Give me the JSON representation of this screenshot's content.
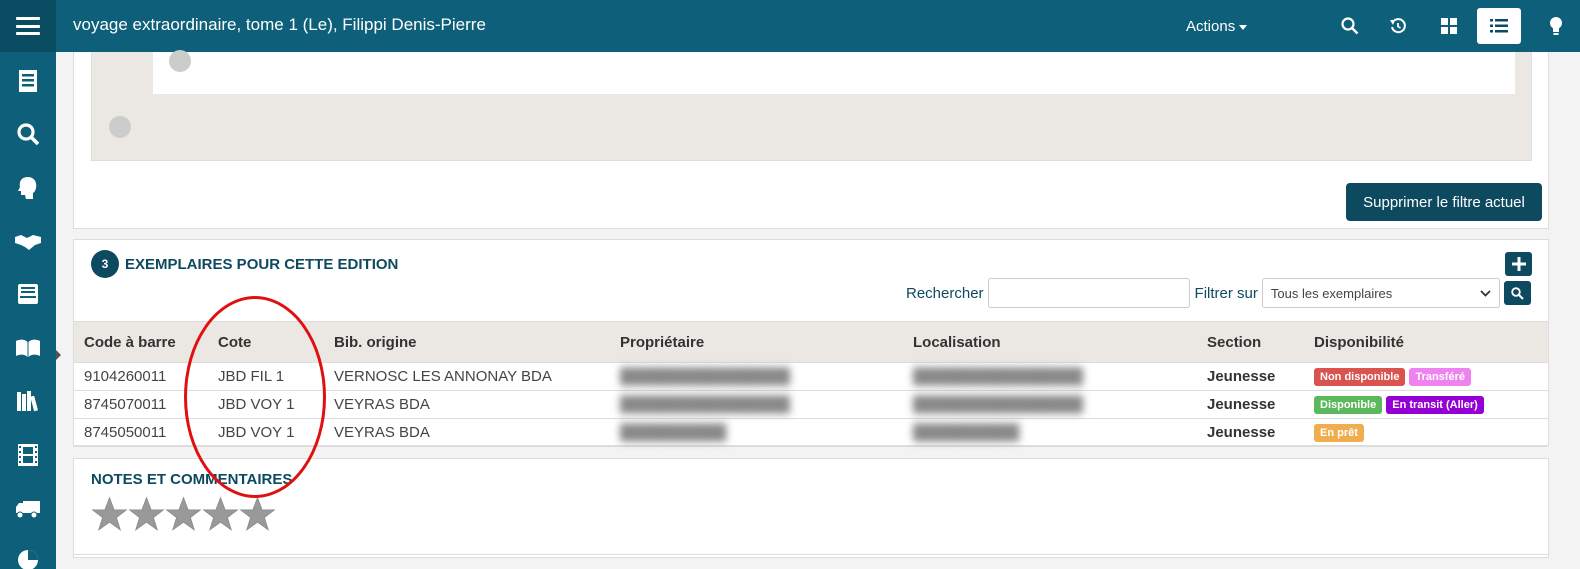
{
  "header": {
    "title": "voyage extraordinaire, tome 1 (Le), Filippi Denis-Pierre",
    "actions_label": "Actions",
    "icons": [
      "menu-icon",
      "search-icon",
      "history-icon",
      "grid-view-icon",
      "list-view-icon",
      "lightbulb-icon"
    ]
  },
  "sidebar": {
    "icons": [
      "catalog-icon",
      "search-icon",
      "user-head-icon",
      "handshake-icon",
      "inbox-icon",
      "open-book-icon",
      "books-icon",
      "film-icon",
      "truck-icon",
      "pie-chart-icon"
    ]
  },
  "filter": {
    "remove_button": "Supprimer le filtre actuel"
  },
  "copies": {
    "count": "3",
    "title": "EXEMPLAIRES POUR CETTE EDITION",
    "search_label": "Rechercher",
    "search_value": "",
    "filter_label": "Filtrer sur",
    "filter_selected": "Tous les exemplaires",
    "columns": [
      "Code à barre",
      "Cote",
      "Bib. origine",
      "Propriétaire",
      "Localisation",
      "Section",
      "Disponibilité"
    ],
    "rows": [
      {
        "barcode": "9104260011",
        "cote": "JBD FIL 1",
        "origin": "VERNOSC LES ANNONAY BDA",
        "owner": "",
        "location": "",
        "section": "Jeunesse",
        "badges": [
          {
            "label": "Non disponible",
            "color": "#d9534f"
          },
          {
            "label": "Transféré",
            "color": "#ee82ee"
          }
        ]
      },
      {
        "barcode": "8745070011",
        "cote": "JBD VOY 1",
        "origin": "VEYRAS BDA",
        "owner": "",
        "location": "",
        "section": "Jeunesse",
        "badges": [
          {
            "label": "Disponible",
            "color": "#5cb85c"
          },
          {
            "label": "En transit (Aller)",
            "color": "#9400d3"
          }
        ]
      },
      {
        "barcode": "8745050011",
        "cote": "JBD VOY 1",
        "origin": "VEYRAS BDA",
        "owner": "",
        "location": "",
        "section": "Jeunesse",
        "badges": [
          {
            "label": "En prêt",
            "color": "#f0ad4e"
          }
        ]
      }
    ]
  },
  "notes": {
    "title": "NOTES ET COMMENTAIRES",
    "rating": 0,
    "max_rating": 5
  },
  "colors": {
    "primary": "#0d5f7a",
    "dark": "#0d4a5f",
    "annotation": "#e01010"
  }
}
